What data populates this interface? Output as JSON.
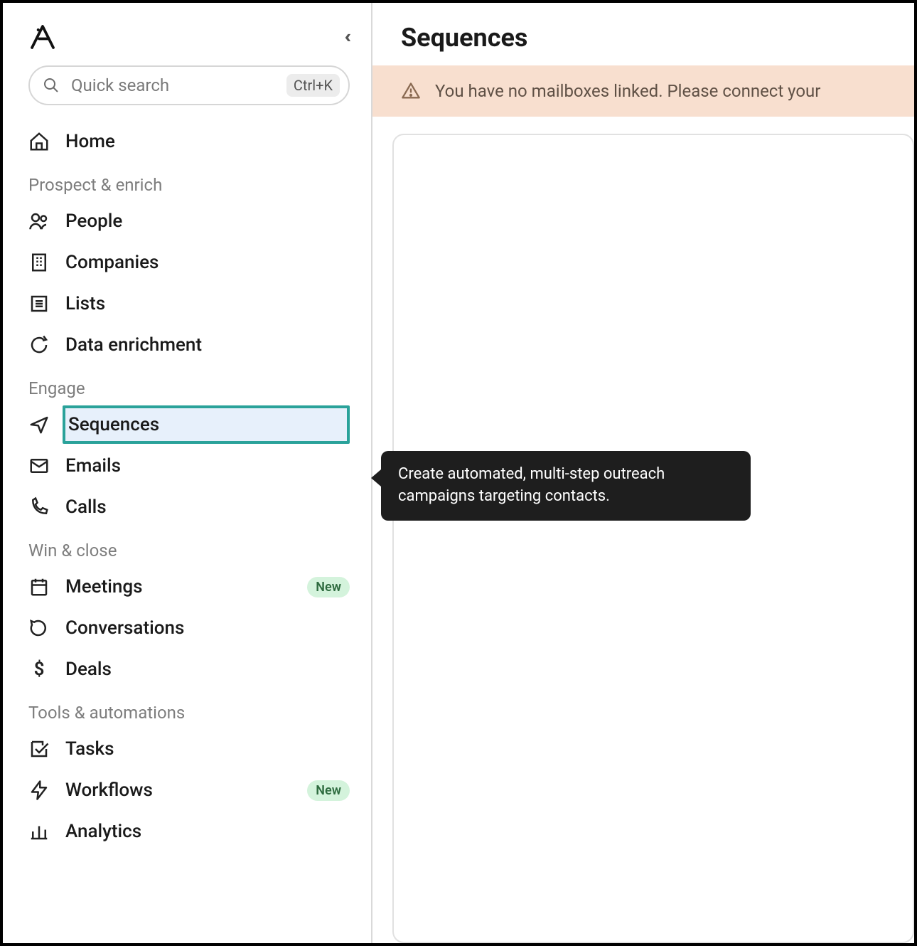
{
  "sidebar": {
    "search_placeholder": "Quick search",
    "search_kbd": "Ctrl+K",
    "home": "Home",
    "sections": [
      {
        "header": "Prospect & enrich",
        "items": [
          {
            "id": "people",
            "label": "People"
          },
          {
            "id": "companies",
            "label": "Companies"
          },
          {
            "id": "lists",
            "label": "Lists"
          },
          {
            "id": "data-enrichment",
            "label": "Data enrichment"
          }
        ]
      },
      {
        "header": "Engage",
        "items": [
          {
            "id": "sequences",
            "label": "Sequences"
          },
          {
            "id": "emails",
            "label": "Emails"
          },
          {
            "id": "calls",
            "label": "Calls"
          }
        ]
      },
      {
        "header": "Win & close",
        "items": [
          {
            "id": "meetings",
            "label": "Meetings",
            "badge": "New"
          },
          {
            "id": "conversations",
            "label": "Conversations"
          },
          {
            "id": "deals",
            "label": "Deals"
          }
        ]
      },
      {
        "header": "Tools & automations",
        "items": [
          {
            "id": "tasks",
            "label": "Tasks"
          },
          {
            "id": "workflows",
            "label": "Workflows",
            "badge": "New"
          },
          {
            "id": "analytics",
            "label": "Analytics"
          }
        ]
      }
    ]
  },
  "main": {
    "title": "Sequences",
    "alert": "You have no mailboxes linked. Please connect your",
    "tooltip": "Create automated, multi-step outreach campaigns targeting contacts."
  }
}
